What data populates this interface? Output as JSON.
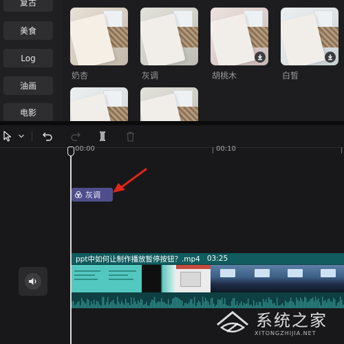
{
  "categories": [
    {
      "label": "复古"
    },
    {
      "label": "美食"
    },
    {
      "label": "Log"
    },
    {
      "label": "油画"
    },
    {
      "label": "电影"
    }
  ],
  "filters": [
    {
      "label": "奶杏",
      "download": false
    },
    {
      "label": "灰调",
      "download": false
    },
    {
      "label": "胡桃木",
      "download": true
    },
    {
      "label": "白皙",
      "download": true
    },
    {
      "label": "",
      "download": false
    },
    {
      "label": "",
      "download": false
    }
  ],
  "toolbar": {
    "select_tool": "select-arrow",
    "undo": "undo",
    "redo": "redo",
    "split": "split",
    "delete": "delete"
  },
  "ruler": {
    "start_label": "00:00",
    "mark_label": "00:10"
  },
  "filter_clip": {
    "label": "灰调"
  },
  "video_clip": {
    "name": "ppt中如何让制作播放暂停按钮？.mp4",
    "duration": "03:25"
  },
  "watermark": {
    "title": "系统之家",
    "url": "XITONGZHIJIA.NET"
  },
  "colors": {
    "filter_clip": "#4f4e8c",
    "video_clip_header": "#115c5e",
    "arrow": "#e0261b"
  }
}
